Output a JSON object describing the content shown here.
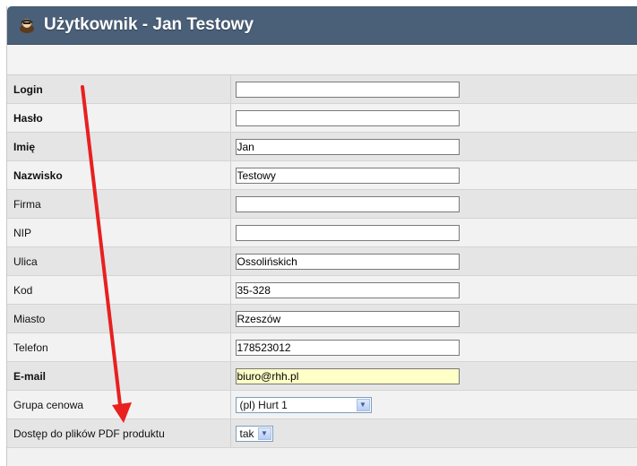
{
  "window": {
    "title": "Użytkownik - Jan Testowy",
    "title_icon": "user-icon",
    "header_color": "#4a5f78"
  },
  "fields": [
    {
      "label": "Login",
      "value": "",
      "bold": true
    },
    {
      "label": "Hasło",
      "value": "",
      "bold": true
    },
    {
      "label": "Imię",
      "value": "Jan",
      "bold": true
    },
    {
      "label": "Nazwisko",
      "value": "Testowy",
      "bold": true
    },
    {
      "label": "Firma",
      "value": "",
      "bold": false
    },
    {
      "label": "NIP",
      "value": "",
      "bold": false
    },
    {
      "label": "Ulica",
      "value": "Ossolińskich",
      "bold": false
    },
    {
      "label": "Kod",
      "value": "35-328",
      "bold": false
    },
    {
      "label": "Miasto",
      "value": "Rzeszów",
      "bold": false
    },
    {
      "label": "Telefon",
      "value": "178523012",
      "bold": false
    },
    {
      "label": "E-mail",
      "value": "biuro@rhh.pl",
      "bold": true,
      "highlight_color": "#ffffc8"
    }
  ],
  "price_group": {
    "label": "Grupa cenowa",
    "selected": "(pl) Hurt 1"
  },
  "pdf_access": {
    "label": "Dostęp do plików PDF produktu",
    "selected": "tak"
  },
  "annotation": {
    "type": "arrow",
    "color": "#e82020"
  }
}
